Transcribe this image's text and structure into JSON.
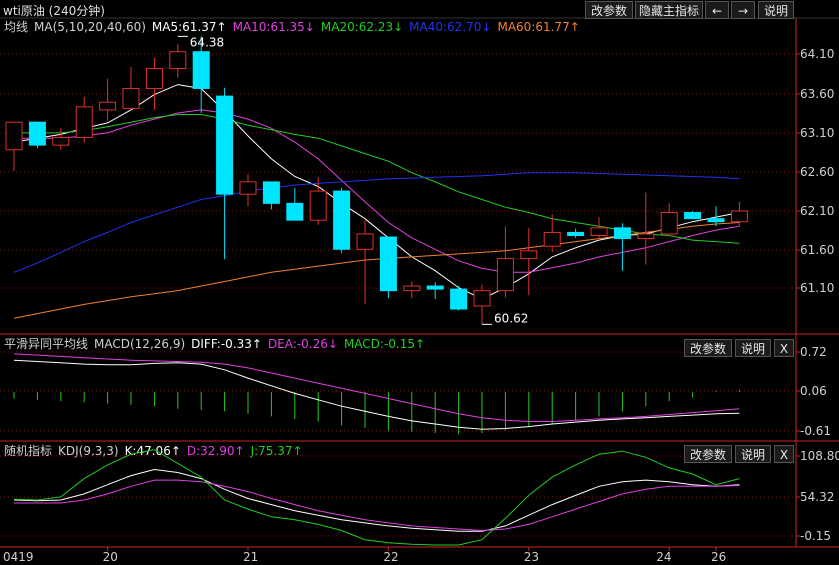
{
  "window": {
    "title": "wti原油 (240分钟)"
  },
  "toolbar": {
    "params_label": "改参数",
    "hide_indicator_label": "隐藏主指标",
    "left_arrow": "←",
    "right_arrow": "→",
    "help_label": "说明",
    "close_label": "X"
  },
  "colors": {
    "up": "#e03030",
    "down": "#00e5ff",
    "white": "#ffffff",
    "magenta": "#e040e0",
    "green": "#22cc22",
    "blue": "#2233ee",
    "orange": "#f08030",
    "axis": "#cc2222",
    "text": "#d0d0d0"
  },
  "chart_data": [
    {
      "type": "candlestick",
      "title": "均线",
      "legend": [
        {
          "name": "MA(5,10,20,40,60)",
          "color": "#d0d0d0"
        },
        {
          "name": "MA5:61.37↑",
          "color": "#ffffff"
        },
        {
          "name": "MA10:61.35↓",
          "color": "#e040e0"
        },
        {
          "name": "MA20:62.23↓",
          "color": "#22cc22"
        },
        {
          "name": "MA40:62.70↓",
          "color": "#2233ee"
        },
        {
          "name": "MA60:61.77↑",
          "color": "#f08030"
        }
      ],
      "y_ticks": [
        "64.10",
        "63.60",
        "63.10",
        "62.60",
        "62.10",
        "61.60",
        "61.10"
      ],
      "ylim": [
        60.52,
        64.62
      ],
      "annotations": [
        {
          "text": "64.38",
          "index": 7,
          "value": 64.38
        },
        {
          "text": "60.62",
          "index": 20,
          "value": 60.62
        }
      ],
      "candles": [
        {
          "o": 62.9,
          "h": 63.26,
          "l": 62.62,
          "c": 63.26
        },
        {
          "o": 63.26,
          "h": 63.23,
          "l": 62.92,
          "c": 62.96
        },
        {
          "o": 62.96,
          "h": 63.18,
          "l": 62.9,
          "c": 63.06
        },
        {
          "o": 63.06,
          "h": 63.59,
          "l": 62.99,
          "c": 63.46
        },
        {
          "o": 63.42,
          "h": 63.83,
          "l": 63.28,
          "c": 63.52
        },
        {
          "o": 63.44,
          "h": 63.98,
          "l": 63.42,
          "c": 63.7
        },
        {
          "o": 63.7,
          "h": 64.1,
          "l": 63.42,
          "c": 63.96
        },
        {
          "o": 63.96,
          "h": 64.28,
          "l": 63.84,
          "c": 64.18
        },
        {
          "o": 64.18,
          "h": 64.38,
          "l": 63.38,
          "c": 63.7
        },
        {
          "o": 63.6,
          "h": 63.71,
          "l": 61.47,
          "c": 62.32
        },
        {
          "o": 62.32,
          "h": 62.58,
          "l": 62.16,
          "c": 62.48
        },
        {
          "o": 62.48,
          "h": 62.46,
          "l": 62.12,
          "c": 62.2
        },
        {
          "o": 62.2,
          "h": 62.4,
          "l": 62.06,
          "c": 61.98
        },
        {
          "o": 61.98,
          "h": 62.54,
          "l": 61.92,
          "c": 62.36
        },
        {
          "o": 62.36,
          "h": 62.4,
          "l": 61.55,
          "c": 61.6
        },
        {
          "o": 61.6,
          "h": 62.0,
          "l": 60.88,
          "c": 61.8
        },
        {
          "o": 61.76,
          "h": 61.6,
          "l": 60.96,
          "c": 61.06
        },
        {
          "o": 61.06,
          "h": 61.18,
          "l": 60.96,
          "c": 61.12
        },
        {
          "o": 61.12,
          "h": 61.17,
          "l": 60.95,
          "c": 61.08
        },
        {
          "o": 61.08,
          "h": 61.12,
          "l": 60.8,
          "c": 60.82
        },
        {
          "o": 60.86,
          "h": 61.14,
          "l": 60.62,
          "c": 61.06
        },
        {
          "o": 61.06,
          "h": 61.9,
          "l": 60.97,
          "c": 61.48
        },
        {
          "o": 61.48,
          "h": 61.88,
          "l": 61.0,
          "c": 61.58
        },
        {
          "o": 61.64,
          "h": 62.06,
          "l": 61.56,
          "c": 61.82
        },
        {
          "o": 61.82,
          "h": 61.87,
          "l": 61.75,
          "c": 61.78
        },
        {
          "o": 61.78,
          "h": 62.02,
          "l": 61.72,
          "c": 61.88
        },
        {
          "o": 61.88,
          "h": 61.94,
          "l": 61.32,
          "c": 61.74
        },
        {
          "o": 61.74,
          "h": 62.34,
          "l": 61.4,
          "c": 61.8
        },
        {
          "o": 61.8,
          "h": 62.2,
          "l": 61.8,
          "c": 62.08
        },
        {
          "o": 62.08,
          "h": 62.1,
          "l": 62.0,
          "c": 62.0
        },
        {
          "o": 62.0,
          "h": 62.16,
          "l": 61.9,
          "c": 61.96
        },
        {
          "o": 61.96,
          "h": 62.22,
          "l": 61.9,
          "c": 62.1
        }
      ],
      "series": [
        {
          "color": "#ffffff",
          "values": [
            63.0,
            63.05,
            63.1,
            63.18,
            63.25,
            63.42,
            63.62,
            63.75,
            63.7,
            63.4,
            63.08,
            62.78,
            62.55,
            62.42,
            62.2,
            62.0,
            61.75,
            61.5,
            61.32,
            61.1,
            60.95,
            61.1,
            61.28,
            61.5,
            61.62,
            61.72,
            61.78,
            61.8,
            61.88,
            61.96,
            62.02,
            62.08
          ]
        },
        {
          "color": "#e040e0",
          "values": [
            63.05,
            63.05,
            63.05,
            63.08,
            63.12,
            63.22,
            63.3,
            63.38,
            63.42,
            63.38,
            63.3,
            63.18,
            63.0,
            62.78,
            62.5,
            62.22,
            61.95,
            61.75,
            61.6,
            61.45,
            61.35,
            61.3,
            61.3,
            61.36,
            61.42,
            61.5,
            61.56,
            61.62,
            61.7,
            61.78,
            61.85,
            61.9
          ]
        },
        {
          "color": "#22cc22",
          "values": [
            63.12,
            63.12,
            63.12,
            63.15,
            63.2,
            63.26,
            63.32,
            63.36,
            63.36,
            63.3,
            63.22,
            63.16,
            63.1,
            63.05,
            62.95,
            62.85,
            62.75,
            62.6,
            62.48,
            62.35,
            62.25,
            62.15,
            62.08,
            62.0,
            61.95,
            61.9,
            61.85,
            61.8,
            61.78,
            61.72,
            61.7,
            61.68
          ]
        },
        {
          "color": "#2233ee",
          "values": [
            61.3,
            61.42,
            61.56,
            61.7,
            61.82,
            61.95,
            62.05,
            62.15,
            62.25,
            62.3,
            62.36,
            62.4,
            62.44,
            62.46,
            62.48,
            62.5,
            62.52,
            62.53,
            62.54,
            62.55,
            62.56,
            62.58,
            62.6,
            62.6,
            62.6,
            62.59,
            62.58,
            62.57,
            62.56,
            62.55,
            62.54,
            62.52
          ]
        },
        {
          "color": "#f08030",
          "values": [
            60.7,
            60.76,
            60.82,
            60.88,
            60.93,
            60.98,
            61.02,
            61.06,
            61.12,
            61.18,
            61.24,
            61.3,
            61.34,
            61.38,
            61.42,
            61.46,
            61.48,
            61.5,
            61.52,
            61.54,
            61.56,
            61.58,
            61.62,
            61.66,
            61.7,
            61.74,
            61.78,
            61.82,
            61.86,
            61.9,
            61.93,
            61.95
          ]
        }
      ]
    },
    {
      "type": "bar",
      "title": "平滑异同平均线",
      "legend": [
        {
          "name": "MACD(12,26,9)",
          "color": "#d0d0d0"
        },
        {
          "name": "DIFF:-0.33↑",
          "color": "#ffffff"
        },
        {
          "name": "DEA:-0.26↓",
          "color": "#e040e0"
        },
        {
          "name": "MACD:-0.15↑",
          "color": "#22cc22"
        }
      ],
      "y_ticks": [
        "0.72",
        "0.06",
        "-0.61"
      ],
      "ylim": [
        -0.75,
        0.88
      ],
      "histogram": [
        -0.1,
        -0.12,
        -0.14,
        -0.16,
        -0.18,
        -0.2,
        -0.22,
        -0.26,
        -0.28,
        -0.3,
        -0.34,
        -0.38,
        -0.42,
        -0.46,
        -0.52,
        -0.56,
        -0.6,
        -0.62,
        -0.64,
        -0.66,
        -0.64,
        -0.6,
        -0.55,
        -0.5,
        -0.44,
        -0.38,
        -0.3,
        -0.22,
        -0.14,
        -0.08,
        0.03,
        0.04
      ],
      "series": [
        {
          "color": "#ffffff",
          "values": [
            0.5,
            0.48,
            0.46,
            0.44,
            0.43,
            0.43,
            0.45,
            0.46,
            0.44,
            0.35,
            0.22,
            0.1,
            -0.02,
            -0.12,
            -0.22,
            -0.3,
            -0.38,
            -0.45,
            -0.5,
            -0.55,
            -0.58,
            -0.57,
            -0.54,
            -0.5,
            -0.47,
            -0.44,
            -0.42,
            -0.4,
            -0.38,
            -0.36,
            -0.34,
            -0.33
          ]
        },
        {
          "color": "#e040e0",
          "values": [
            0.6,
            0.58,
            0.56,
            0.54,
            0.52,
            0.5,
            0.49,
            0.48,
            0.47,
            0.44,
            0.38,
            0.3,
            0.22,
            0.14,
            0.06,
            -0.02,
            -0.1,
            -0.18,
            -0.26,
            -0.34,
            -0.4,
            -0.44,
            -0.46,
            -0.46,
            -0.44,
            -0.42,
            -0.4,
            -0.38,
            -0.35,
            -0.32,
            -0.29,
            -0.26
          ]
        }
      ]
    },
    {
      "type": "line",
      "title": "随机指标",
      "legend": [
        {
          "name": "KDJ(9,3,3)",
          "color": "#d0d0d0"
        },
        {
          "name": "K:47.06↑",
          "color": "#ffffff"
        },
        {
          "name": "D:32.90↑",
          "color": "#e040e0"
        },
        {
          "name": "J:75.37↑",
          "color": "#22cc22"
        }
      ],
      "y_ticks": [
        "108.80",
        "54.32",
        "-0.15"
      ],
      "ylim": [
        -15,
        120
      ],
      "series": [
        {
          "color": "#ffffff",
          "values": [
            44,
            43,
            44,
            52,
            64,
            76,
            84,
            80,
            72,
            58,
            46,
            38,
            30,
            24,
            18,
            14,
            10,
            7,
            5,
            3,
            3,
            10,
            24,
            38,
            50,
            62,
            68,
            70,
            68,
            64,
            62,
            64
          ]
        },
        {
          "color": "#e040e0",
          "values": [
            40,
            40,
            40,
            44,
            52,
            62,
            70,
            70,
            68,
            62,
            55,
            46,
            38,
            30,
            24,
            18,
            14,
            10,
            8,
            6,
            4,
            6,
            12,
            22,
            32,
            42,
            52,
            58,
            62,
            62,
            62,
            63
          ]
        },
        {
          "color": "#22cc22",
          "values": [
            45,
            44,
            48,
            72,
            90,
            104,
            110,
            92,
            74,
            44,
            32,
            22,
            18,
            12,
            4,
            -8,
            -12,
            -14,
            -15,
            -15,
            -8,
            20,
            50,
            74,
            90,
            104,
            108,
            100,
            86,
            78,
            64,
            72
          ]
        }
      ]
    }
  ],
  "x_ticks": [
    {
      "label": "0419",
      "index": 0
    },
    {
      "label": "20",
      "index": 4
    },
    {
      "label": "21",
      "index": 10
    },
    {
      "label": "22",
      "index": 16
    },
    {
      "label": "23",
      "index": 22
    },
    {
      "label": "24",
      "index": 28
    },
    {
      "label": "26",
      "index": 30
    }
  ]
}
